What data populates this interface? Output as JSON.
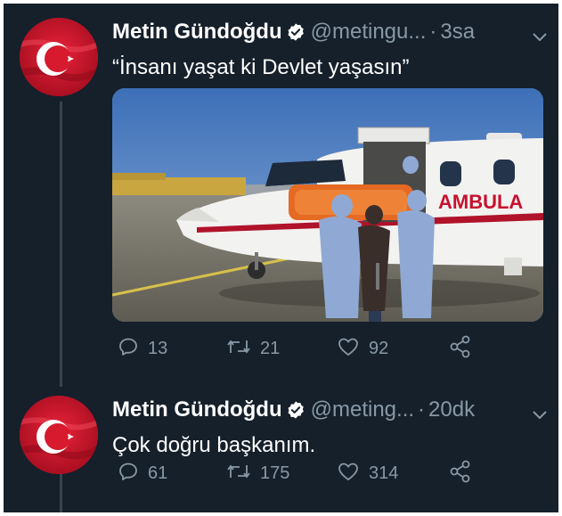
{
  "tweets": [
    {
      "author_name": "Metin Gündoğdu",
      "handle": "@metingu...",
      "separator": "·",
      "time": "3sa",
      "text": "“İnsanı yaşat ki Devlet yaşasın”",
      "media_label": "AMBULA",
      "stats": {
        "replies": "13",
        "retweets": "21",
        "likes": "92"
      }
    },
    {
      "author_name": "Metin Gündoğdu",
      "handle": "@meting...",
      "separator": "·",
      "time": "20dk",
      "text": "Çok doğru başkanım.",
      "stats": {
        "replies": "61",
        "retweets": "175",
        "likes": "314"
      }
    }
  ],
  "colors": {
    "background": "#15202b",
    "text": "#ffffff",
    "muted": "#8899a6",
    "verified": "#ffffff",
    "thread_line": "#38444d",
    "avatar_red": "#c8102e"
  },
  "icons": [
    "turkish-flag-avatar",
    "verified-badge-icon",
    "chevron-down-icon",
    "reply-icon",
    "retweet-icon",
    "like-icon",
    "share-icon"
  ]
}
